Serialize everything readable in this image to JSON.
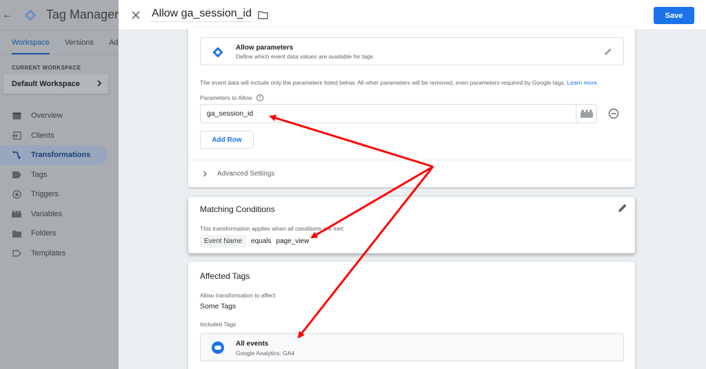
{
  "app": {
    "product_name": "Tag Manager",
    "tabs": [
      "Workspace",
      "Versions",
      "Ad"
    ],
    "current_workspace_label": "CURRENT WORKSPACE",
    "workspace_name": "Default Workspace",
    "nav": [
      {
        "label": "Overview",
        "icon": "overview-icon"
      },
      {
        "label": "Clients",
        "icon": "clients-icon"
      },
      {
        "label": "Transformations",
        "icon": "transformations-icon",
        "active": true
      },
      {
        "label": "Tags",
        "icon": "tag-icon"
      },
      {
        "label": "Triggers",
        "icon": "trigger-icon"
      },
      {
        "label": "Variables",
        "icon": "variables-icon"
      },
      {
        "label": "Folders",
        "icon": "folder-icon"
      },
      {
        "label": "Templates",
        "icon": "template-icon"
      }
    ]
  },
  "editor": {
    "title": "Allow ga_session_id",
    "save_label": "Save"
  },
  "config": {
    "type_title": "Allow parameters",
    "type_subtitle": "Define which event data values are available for tags",
    "description": "The event data will include only the parameters listed below. All other parameters will be removed, even parameters required by Google tags.",
    "learn_more": "Learn more",
    "params_label": "Parameters to Allow",
    "params_help": "?",
    "param_value": "ga_session_id",
    "add_row": "Add Row",
    "advanced": "Advanced Settings"
  },
  "matching": {
    "title": "Matching Conditions",
    "description": "This transformation applies when all conditions are met:",
    "field": "Event Name",
    "operator": "equals",
    "value": "page_view"
  },
  "affected": {
    "title": "Affected Tags",
    "scope_label": "Allow transformation to affect",
    "scope_value": "Some Tags",
    "included_label": "Included Tags",
    "tag_name": "All events",
    "tag_type": "Google Analytics: GA4"
  },
  "colors": {
    "accent": "#1a73e8",
    "annotation_arrow": "#ff0000"
  }
}
